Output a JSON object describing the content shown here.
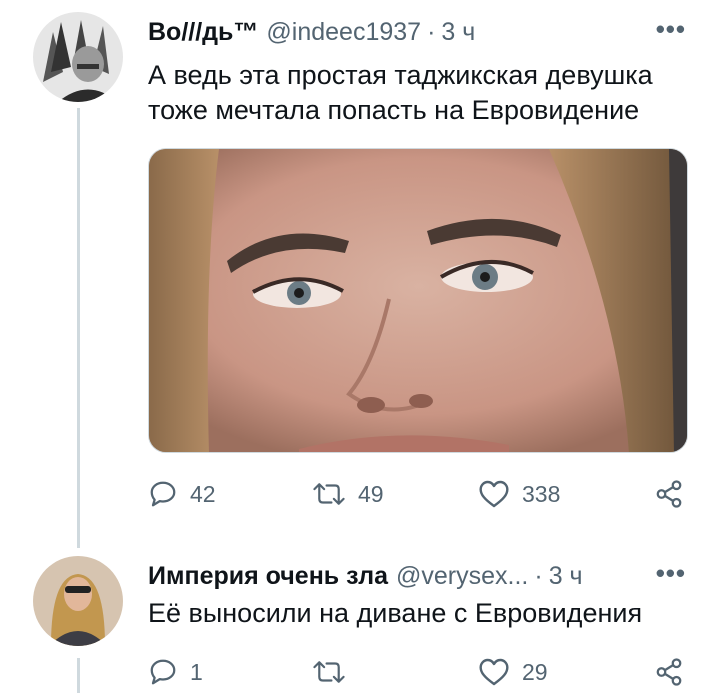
{
  "tweets": [
    {
      "author_name": "Во///дь™",
      "handle": "@indeec1937",
      "separator": "·",
      "time": "3 ч",
      "more": "•••",
      "text_lines": [
        "А ведь эта простая таджикская девушка",
        "тоже мечтала попасть на Евровидение"
      ],
      "replies": "42",
      "retweets": "49",
      "likes": "338"
    },
    {
      "author_name": "Империя очень зла",
      "handle": "@verysex...",
      "separator": "·",
      "time": "3 ч",
      "more": "•••",
      "text_lines": [
        "Её выносили на диване с Евровидения"
      ],
      "replies": "1",
      "retweets": "",
      "likes": "29"
    }
  ],
  "icons": {
    "reply": "reply-icon",
    "retweet": "retweet-icon",
    "like": "heart-icon",
    "share": "share-icon",
    "more": "more-dots-icon"
  },
  "colors": {
    "text": "#0f1419",
    "secondary": "#536471",
    "thread_line": "#cfd9de"
  }
}
